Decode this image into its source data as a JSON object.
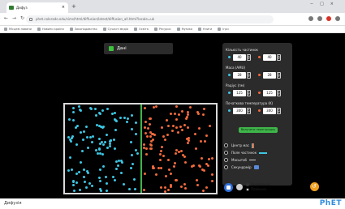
{
  "browser": {
    "tab_title": "Дифуз",
    "url": "phet.colorado.edu/sims/html/diffusion/latest/diffusion_all.html?locale=uk",
    "bookmarks": [
      "Місцеві новини",
      "Новини країни",
      "Законодавство",
      "Сучасні медіа",
      "Освіта",
      "Ресурси",
      "Музика",
      "Книги",
      "Ігри"
    ]
  },
  "sim": {
    "divider_checkbox_label": "Дані",
    "panel": {
      "groups": [
        {
          "title": "Кількість частинок",
          "left": "40",
          "right": "40"
        },
        {
          "title": "Маса (AMU)",
          "left": "28",
          "right": "28"
        },
        {
          "title": "Радіус (пм)",
          "left": "125",
          "right": "125"
        },
        {
          "title": "Початкова температура (K)",
          "left": "300",
          "right": "300"
        }
      ],
      "remove_button": "Вилучити перегородку"
    },
    "options": [
      {
        "label": "Центр мас",
        "swatch": "center-of-mass"
      },
      {
        "label": "Поле частинок",
        "swatch": "particle-flow"
      },
      {
        "label": "Масштаб",
        "swatch": "scale"
      },
      {
        "label": "Секундомір",
        "swatch": "stopwatch"
      }
    ],
    "speed": {
      "normal": "Нормально",
      "slow": "Повільно"
    }
  },
  "footer": {
    "page_title": "Дифузія",
    "brand_main": "PhET",
    "brand_accent": "·"
  },
  "colors": {
    "particle_a": "#3dc6e3",
    "particle_b": "#f06a3c",
    "accent": "#3fb54a"
  }
}
